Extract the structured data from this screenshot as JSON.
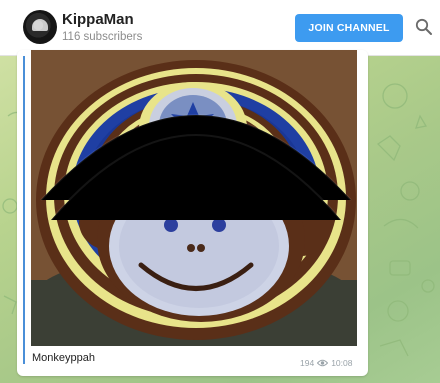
{
  "header": {
    "channel_name": "KippaMan",
    "subscribers": "116 subscribers",
    "join_label": "JOIN CHANNEL",
    "icons": {
      "avatar": "channel-avatar",
      "search": "search-icon"
    }
  },
  "message": {
    "caption": "Monkeyppah",
    "views": "194",
    "time": "10:08",
    "icons": {
      "views": "eye-icon"
    }
  },
  "colors": {
    "accent": "#3d9bf0",
    "chat_bg": "#b7cf8c",
    "kippah_blue": "#1f3fa3",
    "kippah_brown": "#5a2f18",
    "kippah_yellow": "#e8e48a"
  }
}
